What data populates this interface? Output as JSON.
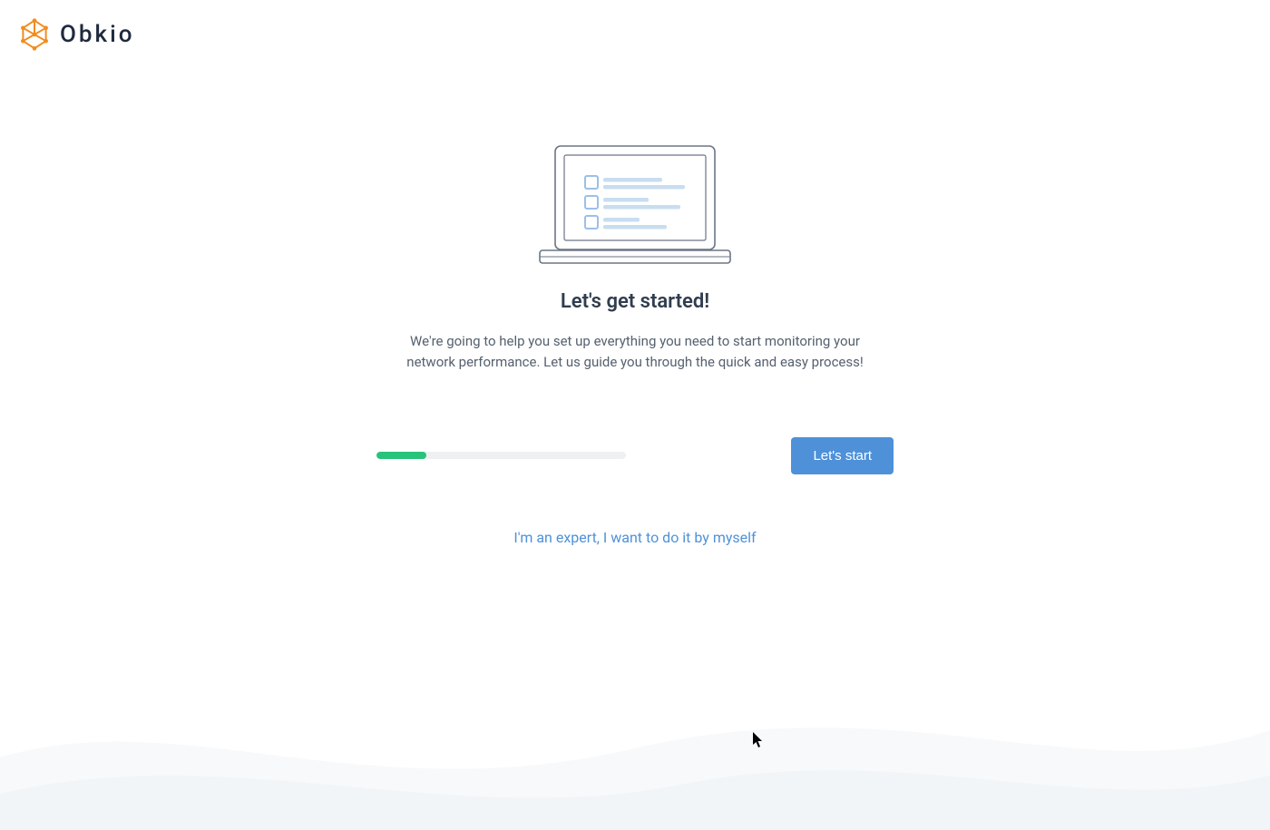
{
  "brand": {
    "name": "Obkio"
  },
  "onboarding": {
    "heading": "Let's get started!",
    "description": "We're going to help you set up everything you need to start monitoring your network performance. Let us guide you through the quick and easy process!",
    "progress_percent": 20,
    "start_button_label": "Let's start",
    "expert_link_label": "I'm an expert, I want to do it by myself"
  },
  "colors": {
    "accent_blue": "#4e91d9",
    "accent_green": "#28c37a",
    "logo_orange": "#f28c1f"
  }
}
